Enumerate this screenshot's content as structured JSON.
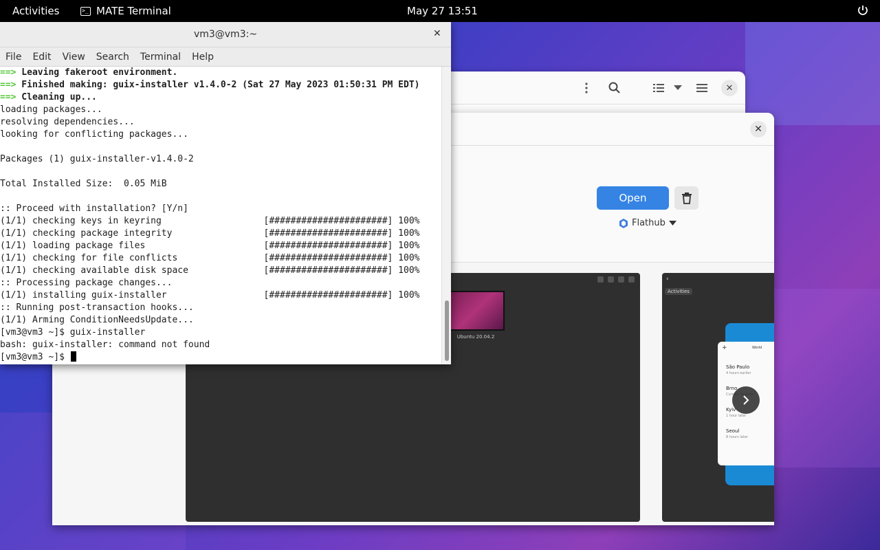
{
  "topbar": {
    "activities": "Activities",
    "app_name": "MATE Terminal",
    "clock": "May 27  13:51"
  },
  "software": {
    "open_label": "Open",
    "source_label": "Flathub",
    "screenshot1_caption": "Ubuntu 20.04.2",
    "screenshot2": {
      "activities": "Activities",
      "world": "World",
      "cities": [
        {
          "name": "São Paulo",
          "sub": "4 hours earlier"
        },
        {
          "name": "Brno",
          "sub": "Current location"
        },
        {
          "name": "Kyiv",
          "sub": "1 hour later"
        },
        {
          "name": "Seoul",
          "sub": "8 hours later"
        }
      ]
    }
  },
  "terminal": {
    "title": "vm3@vm3:~",
    "menu": [
      "File",
      "Edit",
      "View",
      "Search",
      "Terminal",
      "Help"
    ],
    "lines": [
      {
        "arrow": "==>",
        "text": " Leaving fakeroot environment.",
        "bold": true
      },
      {
        "arrow": "==>",
        "text": " Finished making: guix-installer v1.4.0-2 (Sat 27 May 2023 01:50:31 PM EDT)",
        "bold": true
      },
      {
        "arrow": "==>",
        "text": " Cleaning up...",
        "bold": true
      },
      {
        "text": "loading packages..."
      },
      {
        "text": "resolving dependencies..."
      },
      {
        "text": "looking for conflicting packages..."
      },
      {
        "text": ""
      },
      {
        "text": "Packages (1) guix-installer-v1.4.0-2"
      },
      {
        "text": ""
      },
      {
        "text": "Total Installed Size:  0.05 MiB"
      },
      {
        "text": ""
      },
      {
        "text": ":: Proceed with installation? [Y/n]"
      },
      {
        "text": "(1/1) checking keys in keyring                   [######################] 100%"
      },
      {
        "text": "(1/1) checking package integrity                 [######################] 100%"
      },
      {
        "text": "(1/1) loading package files                      [######################] 100%"
      },
      {
        "text": "(1/1) checking for file conflicts                [######################] 100%"
      },
      {
        "text": "(1/1) checking available disk space              [######################] 100%"
      },
      {
        "text": ":: Processing package changes..."
      },
      {
        "text": "(1/1) installing guix-installer                  [######################] 100%"
      },
      {
        "text": ":: Running post-transaction hooks..."
      },
      {
        "text": "(1/1) Arming ConditionNeedsUpdate..."
      },
      {
        "text": "[vm3@vm3 ~]$ guix-installer"
      },
      {
        "text": "bash: guix-installer: command not found"
      },
      {
        "text": "[vm3@vm3 ~]$ ",
        "cursor": true
      }
    ]
  },
  "colors": {
    "accent": "#3584e4",
    "terminal_arrow": "#56c83b",
    "topbar": "#000000"
  },
  "icons": [
    "terminal-icon",
    "power-icon",
    "kebab-menu-icon",
    "search-icon",
    "list-view-icon",
    "chevron-down-icon",
    "hamburger-menu-icon",
    "close-icon",
    "trash-icon",
    "flathub-icon",
    "chevron-right-icon"
  ]
}
